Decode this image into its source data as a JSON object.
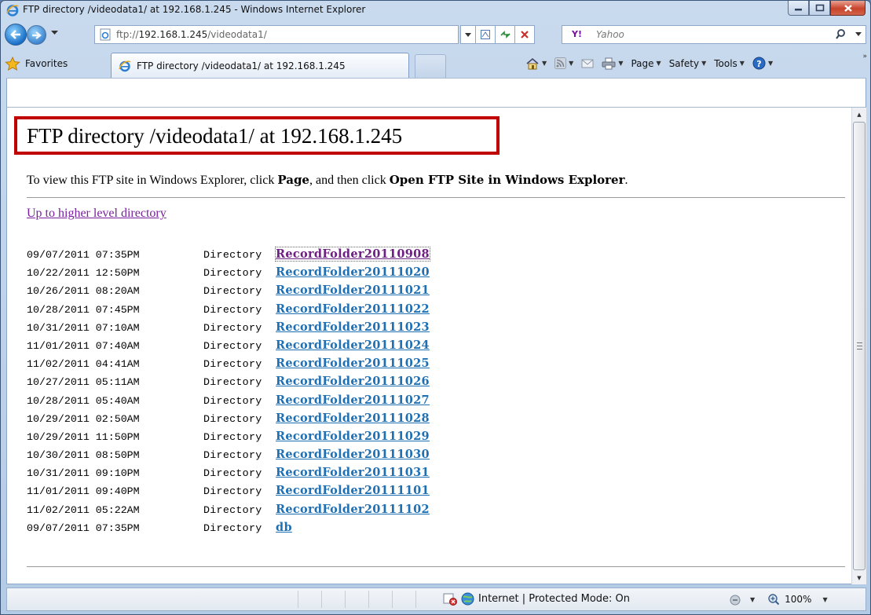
{
  "window": {
    "title": "FTP directory /videodata1/ at 192.168.1.245 - Windows Internet Explorer"
  },
  "address": {
    "prefix": "ftp://",
    "host": "192.168.1.245",
    "path": "/videodata1/"
  },
  "search": {
    "placeholder": "Yahoo",
    "logo": "Y!"
  },
  "toolbar": {
    "favorites": "Favorites",
    "tab_title": "FTP directory /videodata1/ at 192.168.1.245",
    "page": "Page",
    "safety": "Safety",
    "tools": "Tools"
  },
  "page": {
    "heading": "FTP directory /videodata1/ at 192.168.1.245",
    "instr_start": "To view this FTP site in Windows Explorer, click ",
    "instr_page": "Page",
    "instr_mid": ", and then click ",
    "instr_open": "Open FTP Site in Windows Explorer",
    "instr_end": ".",
    "up_link": "Up to higher level directory",
    "entries": [
      {
        "datetime": "09/07/2011 07:35PM",
        "type": "Directory",
        "name": "RecordFolder20110908",
        "visited": true
      },
      {
        "datetime": "10/22/2011 12:50PM",
        "type": "Directory",
        "name": "RecordFolder20111020"
      },
      {
        "datetime": "10/26/2011 08:20AM",
        "type": "Directory",
        "name": "RecordFolder20111021"
      },
      {
        "datetime": "10/28/2011 07:45PM",
        "type": "Directory",
        "name": "RecordFolder20111022"
      },
      {
        "datetime": "10/31/2011 07:10AM",
        "type": "Directory",
        "name": "RecordFolder20111023"
      },
      {
        "datetime": "11/01/2011 07:40AM",
        "type": "Directory",
        "name": "RecordFolder20111024"
      },
      {
        "datetime": "11/02/2011 04:41AM",
        "type": "Directory",
        "name": "RecordFolder20111025"
      },
      {
        "datetime": "10/27/2011 05:11AM",
        "type": "Directory",
        "name": "RecordFolder20111026"
      },
      {
        "datetime": "10/28/2011 05:40AM",
        "type": "Directory",
        "name": "RecordFolder20111027"
      },
      {
        "datetime": "10/29/2011 02:50AM",
        "type": "Directory",
        "name": "RecordFolder20111028"
      },
      {
        "datetime": "10/29/2011 11:50PM",
        "type": "Directory",
        "name": "RecordFolder20111029"
      },
      {
        "datetime": "10/30/2011 08:50PM",
        "type": "Directory",
        "name": "RecordFolder20111030"
      },
      {
        "datetime": "10/31/2011 09:10PM",
        "type": "Directory",
        "name": "RecordFolder20111031"
      },
      {
        "datetime": "11/01/2011 09:40PM",
        "type": "Directory",
        "name": "RecordFolder20111101"
      },
      {
        "datetime": "11/02/2011 05:22AM",
        "type": "Directory",
        "name": "RecordFolder20111102"
      },
      {
        "datetime": "09/07/2011 07:35PM",
        "type": "Directory",
        "name": "db"
      }
    ]
  },
  "status": {
    "zone": "Internet | Protected Mode: On",
    "zoom": "100%"
  },
  "colors": {
    "highlight_border": "#c00000",
    "link": "#1f6fb3",
    "visited": "#6d1f82"
  }
}
